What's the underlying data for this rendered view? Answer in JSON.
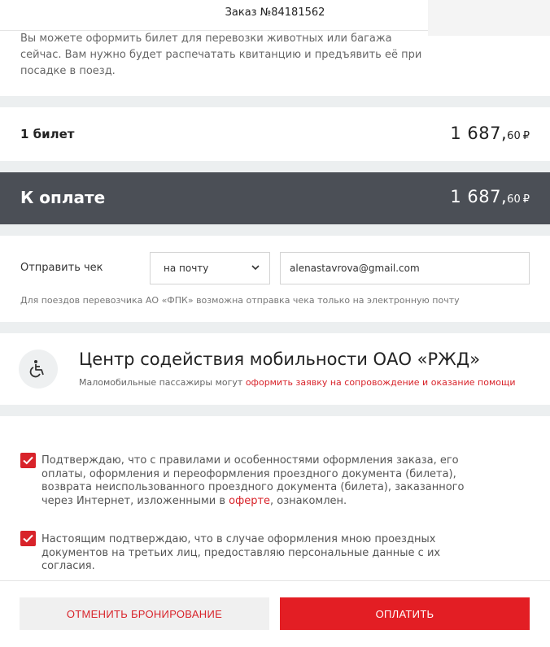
{
  "header": {
    "title": "Заказ №84181562"
  },
  "notice": {
    "text": "Вы можете оформить билет для перевозки животных или багажа сейчас. Вам нужно будет распечатать квитанцию и предъявить её при посадке в поезд."
  },
  "summary": {
    "tickets_label": "1 билет",
    "tickets_price_main": "1 687,",
    "tickets_price_cents": "60",
    "currency": "₽",
    "pay_label": "К оплате",
    "pay_price_main": "1 687,",
    "pay_price_cents": "60"
  },
  "receipt": {
    "label": "Отправить чек",
    "method_selected": "на почту",
    "email_value": "alenastavrova@gmail.com",
    "hint": "Для поездов перевозчика АО «ФПК» возможна отправка чека только на электронную почту"
  },
  "mobility": {
    "title": "Центр содействия мобильности ОАО «РЖД»",
    "sub_prefix": "Маломобильные пассажиры могут ",
    "sub_link": "оформить заявку на сопровождение и оказание помощи",
    "icon": "wheelchair-icon"
  },
  "agreements": {
    "first_text": "Подтверждаю, что с правилами и особенностями оформления заказа, его оплаты, оформления и переоформления проездного документа (билета), возврата неиспользованного проездного документа (билета), заказанного через Интернет, изложенными в ",
    "first_link": "оферте",
    "first_suffix": ", ознакомлен.",
    "first_checked": true,
    "second_text": "Настоящим подтверждаю, что в случае оформления мною проездных документов на третьих лиц, предоставляю персональные данные с их согласия.",
    "second_checked": true
  },
  "buttons": {
    "cancel": "ОТМЕНИТЬ БРОНИРОВАНИЕ",
    "pay": "ОПЛАТИТЬ"
  },
  "colors": {
    "accent": "#e31e24",
    "dark_bar": "#4b4f56",
    "gap": "#eceff0"
  }
}
